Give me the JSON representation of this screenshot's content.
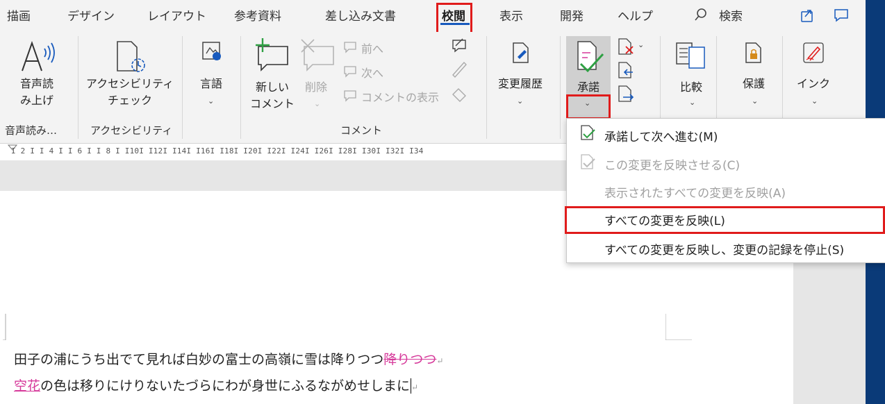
{
  "tabs": [
    {
      "label": "描画",
      "active": false
    },
    {
      "label": "デザイン",
      "active": false
    },
    {
      "label": "レイアウト",
      "active": false
    },
    {
      "label": "参考資料",
      "active": false
    },
    {
      "label": "差し込み文書",
      "active": false
    },
    {
      "label": "校閲",
      "active": true
    },
    {
      "label": "表示",
      "active": false
    },
    {
      "label": "開発",
      "active": false
    },
    {
      "label": "ヘルプ",
      "active": false
    }
  ],
  "search": {
    "label": "検索"
  },
  "ribbon": {
    "read_aloud": "音声読\nみ上げ",
    "accessibility_check": "アクセシビリティ\nチェック",
    "language": "言語",
    "new_comment": "新しい\nコメント",
    "delete": "削除",
    "previous": "前へ",
    "next": "次へ",
    "show_comments": "コメントの表示",
    "track_changes": "変更履歴",
    "accept": "承諾",
    "compare": "比較",
    "protect": "保護",
    "ink": "インク",
    "groups": {
      "speech": "音声読み…",
      "accessibility": "アクセシビリティ",
      "comments": "コメント"
    }
  },
  "ruler": "I 2 I  I 4 I  I 6 I  I 8 I  I10I  I12I  I14I  I16I  I18I  I20I  I22I  I24I  I26I  I28I  I30I  I32I  I34",
  "menu": {
    "items": [
      {
        "label": "承諾して次へ進む(M)",
        "enabled": true
      },
      {
        "label": "この変更を反映させる(C)",
        "enabled": false
      },
      {
        "label": "表示されたすべての変更を反映(A)",
        "enabled": false
      },
      {
        "label": "すべての変更を反映(L)",
        "enabled": true
      },
      {
        "label": "すべての変更を反映し、変更の記録を停止(S)",
        "enabled": true
      }
    ]
  },
  "document": {
    "line1_text": "田子の浦にうち出でて見れば白妙の富士の高嶺に雪は降りつつ",
    "line1_deleted": "降りつつ",
    "line2_inserted": "空花",
    "line2_text": "の色は移りにけりないたづらにわが身世にふるながめせしまに"
  },
  "colors": {
    "accent": "#185abd",
    "highlight": "#e01b1b",
    "revision": "#d6399a"
  }
}
